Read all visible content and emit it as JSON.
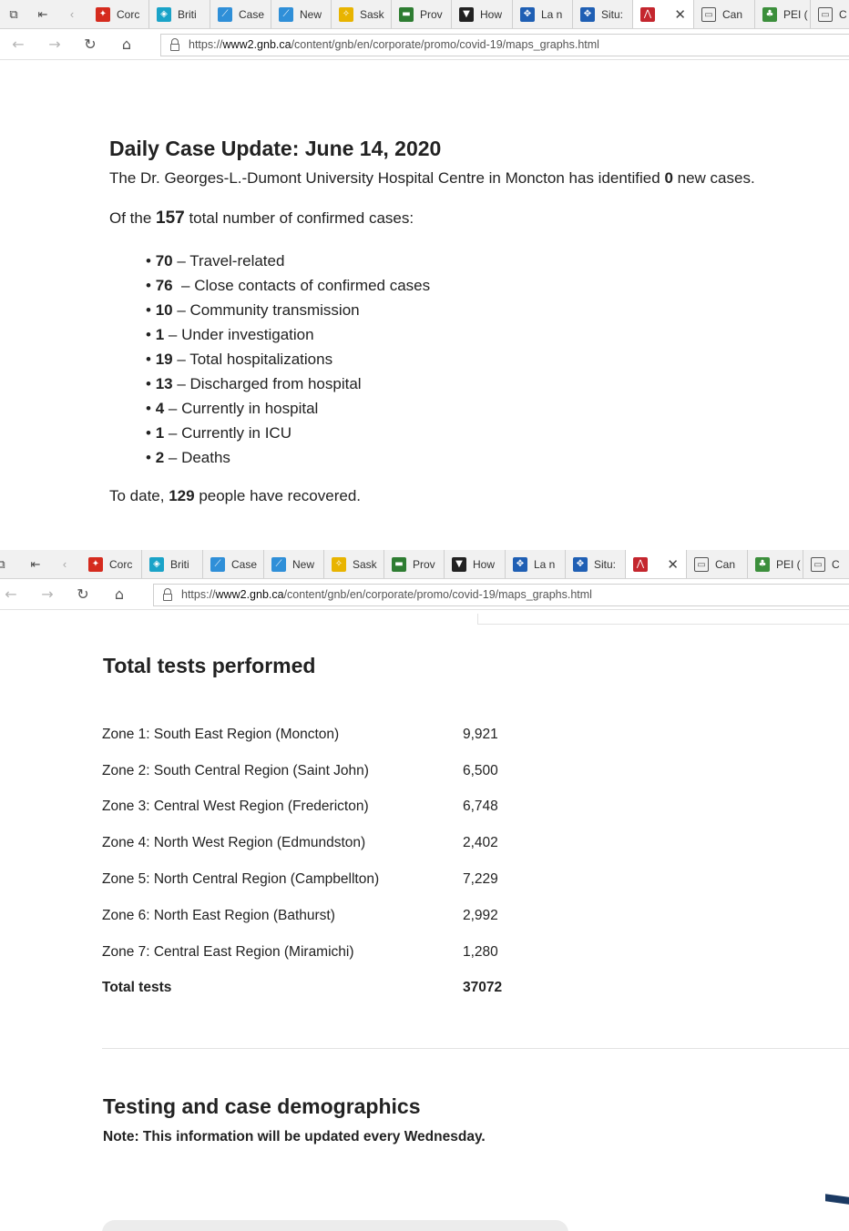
{
  "browser": {
    "tabs": [
      {
        "label": "Corc",
        "icon": "maple-leaf-icon",
        "color": "#d52b1e"
      },
      {
        "label": "Briti",
        "icon": "bc-logo-icon",
        "color": "#1aa3c8"
      },
      {
        "label": "Case",
        "icon": "chart-icon",
        "color": "#2f8fd8"
      },
      {
        "label": "New",
        "icon": "chart-icon",
        "color": "#2f8fd8"
      },
      {
        "label": "Sask",
        "icon": "sask-icon",
        "color": "#e8b400"
      },
      {
        "label": "Prov",
        "icon": "gov-icon",
        "color": "#2e7d32"
      },
      {
        "label": "How",
        "icon": "shield-icon",
        "color": "#222222"
      },
      {
        "label": "La n",
        "icon": "fleur-de-lis-icon",
        "color": "#1f5fb4"
      },
      {
        "label": "Situ:",
        "icon": "fleur-de-lis-icon",
        "color": "#1f5fb4"
      },
      {
        "label": "",
        "icon": "pdf-icon",
        "color": "#c4262e",
        "active": true
      },
      {
        "label": "Can",
        "icon": "window-icon",
        "color": "#555555"
      },
      {
        "label": "PEI (",
        "icon": "pei-icon",
        "color": "#3c8f3c"
      },
      {
        "label": "C",
        "icon": "window-icon",
        "color": "#555555"
      }
    ],
    "url_prefix": "https://",
    "url_domain": "www2.gnb.ca",
    "url_path": "/content/gnb/en/corporate/promo/covid-19/maps_graphs.html"
  },
  "daily": {
    "title": "Daily Case Update: June 14, 2020",
    "hospital_text_a": "The Dr. Georges-L.-Dumont University Hospital Centre in Moncton has identified ",
    "new_cases": "0",
    "hospital_text_b": " new cases.",
    "total_text_a": "Of the ",
    "total_cases": "157",
    "total_text_b": " total number of confirmed cases:",
    "items": [
      {
        "num": "70",
        "sep": " – ",
        "label": "Travel-related"
      },
      {
        "num": "76",
        "sep": "  – ",
        "label": "Close contacts of confirmed cases"
      },
      {
        "num": "10",
        "sep": " – ",
        "label": "Community transmission"
      },
      {
        "num": "1",
        "sep": " – ",
        "label": "Under investigation"
      },
      {
        "num": "19",
        "sep": " – ",
        "label": "Total hospitalizations"
      },
      {
        "num": "13",
        "sep": " – ",
        "label": "Discharged from hospital"
      },
      {
        "num": "4",
        "sep": " – ",
        "label": "Currently in hospital"
      },
      {
        "num": "1",
        "sep": " – ",
        "label": "Currently in ICU"
      },
      {
        "num": "2",
        "sep": " – ",
        "label": "Deaths"
      }
    ],
    "recovered_text_a": "To date, ",
    "recovered": "129",
    "recovered_text_b": " people have recovered."
  },
  "tests": {
    "title": "Total tests performed",
    "zones": [
      {
        "name": "Zone 1: South East Region (Moncton)",
        "value": "9,921"
      },
      {
        "name": "Zone 2: South Central Region (Saint John)",
        "value": "6,500"
      },
      {
        "name": "Zone 3: Central West Region (Fredericton)",
        "value": "6,748"
      },
      {
        "name": "Zone 4: North West Region (Edmundston)",
        "value": "2,402"
      },
      {
        "name": "Zone 5: North Central Region (Campbellton)",
        "value": "7,229"
      },
      {
        "name": "Zone 6: North East Region (Bathurst)",
        "value": "2,992"
      },
      {
        "name": "Zone 7: Central East Region (Miramichi)",
        "value": "1,280"
      }
    ],
    "total_label": "Total tests",
    "total_value": "37072"
  },
  "demographics": {
    "title": "Testing and case demographics",
    "note": "Note: This information will be updated every Wednesday."
  }
}
